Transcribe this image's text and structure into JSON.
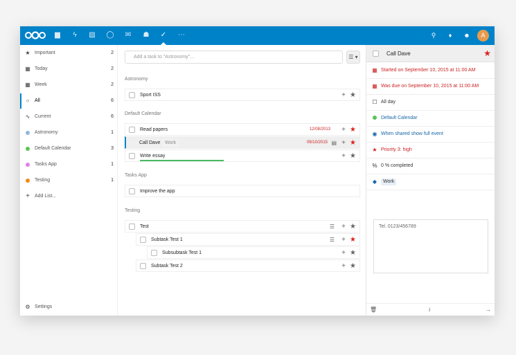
{
  "topbar": {
    "apps": [
      "files-icon",
      "activity-icon",
      "gallery-icon",
      "search-app-icon",
      "mail-icon",
      "contacts-icon",
      "tasks-icon",
      "more-icon"
    ],
    "avatar_letter": "A"
  },
  "sidebar": {
    "items": [
      {
        "label": "Important",
        "count": "2",
        "icon": "★"
      },
      {
        "label": "Today",
        "count": "2",
        "icon": "▦"
      },
      {
        "label": "Week",
        "count": "2",
        "icon": "▦"
      },
      {
        "label": "All",
        "count": "6",
        "icon": "○"
      },
      {
        "label": "Current",
        "count": "6",
        "icon": "∿"
      },
      {
        "label": "Astronomy",
        "count": "1",
        "color": "#8fb7e0"
      },
      {
        "label": "Default Calendar",
        "count": "3",
        "color": "#5bc35b"
      },
      {
        "label": "Tasks App",
        "count": "1",
        "color": "#e080e8"
      },
      {
        "label": "Testing",
        "count": "1",
        "color": "#f28a16"
      }
    ],
    "add_list": "Add List...",
    "settings": "Settings"
  },
  "main": {
    "add_placeholder": "Add a task to \"Astronomy\"...",
    "groups": [
      {
        "heading": "Astronomy"
      },
      {
        "heading": "Default Calendar"
      },
      {
        "heading": "Tasks App"
      },
      {
        "heading": "Testing"
      }
    ],
    "tasks": [
      {
        "title": "Sport ISS"
      },
      {
        "title": "Read papers",
        "date": "12/08/2013"
      },
      {
        "title": "Call Dave",
        "tag": "Work",
        "date": "09/10/2015"
      },
      {
        "title": "Write essay"
      },
      {
        "title": "Improve the app"
      },
      {
        "title": "Test"
      },
      {
        "title": "Subtask Test 1"
      },
      {
        "title": "Subsubtask Test 1"
      },
      {
        "title": "Subtask Test 2"
      }
    ]
  },
  "details": {
    "title": "Call Dave",
    "started": "Started on September 10, 2015 at 11:00 AM",
    "due": "Was due on September 10, 2015 at 11:00 AM",
    "all_day": "All day",
    "calendar": "Default Calendar",
    "shared": "When shared show full event",
    "priority": "Priority 3: high",
    "completed": "0 % completed",
    "tag": "Work",
    "notes": "Tel. 0123/456789"
  },
  "colors": {
    "accent": "#0082c9",
    "star_red": "#dd2222",
    "progress": "#46ba61"
  }
}
